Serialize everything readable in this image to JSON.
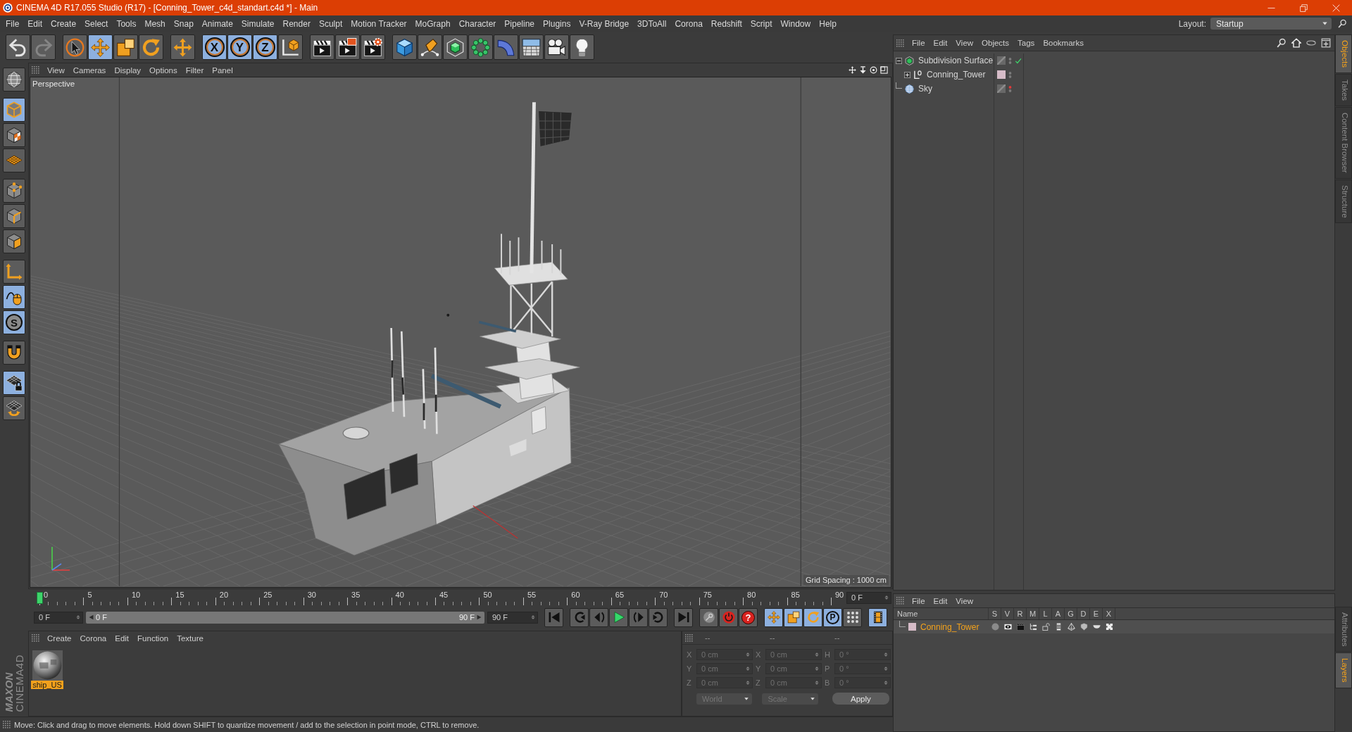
{
  "window": {
    "title": "CINEMA 4D R17.055 Studio (R17) - [Conning_Tower_c4d_standart.c4d *] - Main"
  },
  "menu_bar": {
    "items": [
      "File",
      "Edit",
      "Create",
      "Select",
      "Tools",
      "Mesh",
      "Snap",
      "Animate",
      "Simulate",
      "Render",
      "Sculpt",
      "Motion Tracker",
      "MoGraph",
      "Character",
      "Pipeline",
      "Plugins",
      "V-Ray Bridge",
      "3DToAll",
      "Corona",
      "Redshift",
      "Script",
      "Window",
      "Help"
    ],
    "layout_label": "Layout:",
    "layout_value": "Startup"
  },
  "toolbar": {
    "history": [
      {
        "kind": "undo",
        "disabled": false
      },
      {
        "kind": "redo",
        "disabled": true
      }
    ],
    "groups": [
      [
        {
          "kind": "select",
          "on": false
        },
        {
          "kind": "move",
          "on": true
        },
        {
          "kind": "scale",
          "on": false
        },
        {
          "kind": "rotate",
          "on": false
        }
      ],
      [
        {
          "kind": "transform",
          "on": false
        }
      ],
      [
        {
          "kind": "axis",
          "label": "X",
          "on": true
        },
        {
          "kind": "axis",
          "label": "Y",
          "on": true
        },
        {
          "kind": "axis",
          "label": "Z",
          "on": true
        },
        {
          "kind": "coords",
          "on": false
        }
      ],
      [
        {
          "kind": "render_view",
          "on": false
        },
        {
          "kind": "render_picture",
          "on": false
        },
        {
          "kind": "render_settings",
          "on": false
        }
      ],
      [
        {
          "kind": "cube",
          "on": false
        },
        {
          "kind": "pen",
          "on": false
        },
        {
          "kind": "subdivision",
          "on": false
        },
        {
          "kind": "cloner",
          "on": false
        },
        {
          "kind": "bend",
          "on": false
        },
        {
          "kind": "floor",
          "on": false
        },
        {
          "kind": "camera",
          "on": false
        },
        {
          "kind": "light",
          "on": false
        }
      ]
    ]
  },
  "mode_palette": {
    "groups": [
      [
        {
          "kind": "sculpt",
          "on": false
        }
      ],
      [
        {
          "kind": "model",
          "on": true
        },
        {
          "kind": "texture",
          "on": false
        },
        {
          "kind": "workplane",
          "on": false
        }
      ],
      [
        {
          "kind": "points",
          "on": false
        },
        {
          "kind": "edges",
          "on": false
        },
        {
          "kind": "polygons",
          "on": false
        }
      ],
      [
        {
          "kind": "axis_mode",
          "on": false
        },
        {
          "kind": "tweak",
          "on": true
        },
        {
          "kind": "snap",
          "label": "S",
          "on": true
        }
      ],
      [
        {
          "kind": "magnet",
          "on": false
        }
      ],
      [
        {
          "kind": "grid_lock",
          "on": true
        },
        {
          "kind": "grid_rotate",
          "on": false
        }
      ]
    ],
    "logo": {
      "brand": "MAXON",
      "product": "CINEMA4D"
    }
  },
  "viewport": {
    "menu": [
      "View",
      "Cameras",
      "Display",
      "Options",
      "Filter",
      "Panel"
    ],
    "camera": "Perspective",
    "grid_spacing": "Grid Spacing : 1000 cm"
  },
  "object_manager": {
    "menu": [
      "File",
      "Edit",
      "View",
      "Objects",
      "Tags",
      "Bookmarks"
    ],
    "objects": [
      {
        "name": "Subdivision Surface",
        "kind": "subdivision",
        "expanded": true,
        "hidden_in_editor": false,
        "enabled": true,
        "children": [
          {
            "name": "Conning_Tower",
            "kind": "null",
            "expanded": false,
            "color": "#d6bcc8",
            "hidden_in_editor": false
          }
        ]
      },
      {
        "name": "Sky",
        "kind": "sky",
        "hidden_in_editor": true
      }
    ]
  },
  "timeline": {
    "ticks": [
      "0",
      "5",
      "10",
      "15",
      "20",
      "25",
      "30",
      "35",
      "40",
      "45",
      "50",
      "55",
      "60",
      "65",
      "70",
      "75",
      "80",
      "85",
      "90"
    ],
    "level": 0,
    "current": "0 F",
    "start": "0 F",
    "range": {
      "start": "0 F",
      "end": "90 F"
    },
    "end": "90 F",
    "groups": [
      [
        {
          "kind": "to_start"
        }
      ],
      [
        {
          "kind": "prev_key"
        },
        {
          "kind": "prev_frame"
        },
        {
          "kind": "play"
        },
        {
          "kind": "next_frame"
        },
        {
          "kind": "next_key"
        }
      ],
      [
        {
          "kind": "to_end"
        }
      ],
      [
        {
          "kind": "autokey"
        },
        {
          "kind": "record"
        },
        {
          "kind": "help",
          "label": "?"
        }
      ],
      [
        {
          "kind": "move",
          "on": true
        },
        {
          "kind": "scale",
          "on": true
        },
        {
          "kind": "rotate",
          "on": true
        },
        {
          "kind": "param",
          "label": "P",
          "on": true
        },
        {
          "kind": "point_level",
          "on": false
        }
      ],
      [
        {
          "kind": "timeline",
          "on": true
        }
      ]
    ]
  },
  "material_manager": {
    "menu": [
      "Create",
      "Corona",
      "Edit",
      "Function",
      "Texture"
    ],
    "materials": [
      {
        "name": "ship_US",
        "selected": true
      }
    ]
  },
  "coordinates": {
    "headers": [
      "--",
      "--",
      "--"
    ],
    "disabled": true,
    "rows": [
      {
        "position_axis": "X",
        "position": "0 cm",
        "size_axis": "X",
        "size": "0 cm",
        "rotation_axis": "H",
        "rotation": "0 °"
      },
      {
        "position_axis": "Y",
        "position": "0 cm",
        "size_axis": "Y",
        "size": "0 cm",
        "rotation_axis": "P",
        "rotation": "0 °"
      },
      {
        "position_axis": "Z",
        "position": "0 cm",
        "size_axis": "Z",
        "size": "0 cm",
        "rotation_axis": "B",
        "rotation": "0 °"
      }
    ],
    "position_mode": "World",
    "size_mode": "Scale",
    "apply": "Apply"
  },
  "layer_manager": {
    "menu": [
      "File",
      "Edit",
      "View"
    ],
    "columns": [
      "Name",
      "S",
      "V",
      "R",
      "M",
      "L",
      "A",
      "G",
      "D",
      "E",
      "X"
    ],
    "layers": [
      {
        "name": "Conning_Tower",
        "color": "#d6bcc8",
        "selected": true
      }
    ]
  },
  "side_tabs": {
    "top": [
      {
        "label": "Objects",
        "selected": true
      },
      {
        "label": "Takes",
        "selected": false
      },
      {
        "label": "Content Browser",
        "selected": false
      },
      {
        "label": "Structure",
        "selected": false
      }
    ],
    "bottom": [
      {
        "label": "Attributes",
        "selected": false
      },
      {
        "label": "Layers",
        "selected": true
      }
    ]
  },
  "status_bar": {
    "text": "Move: Click and drag to move elements. Hold down SHIFT to quantize movement / add to the selection in point mode, CTRL to remove."
  }
}
